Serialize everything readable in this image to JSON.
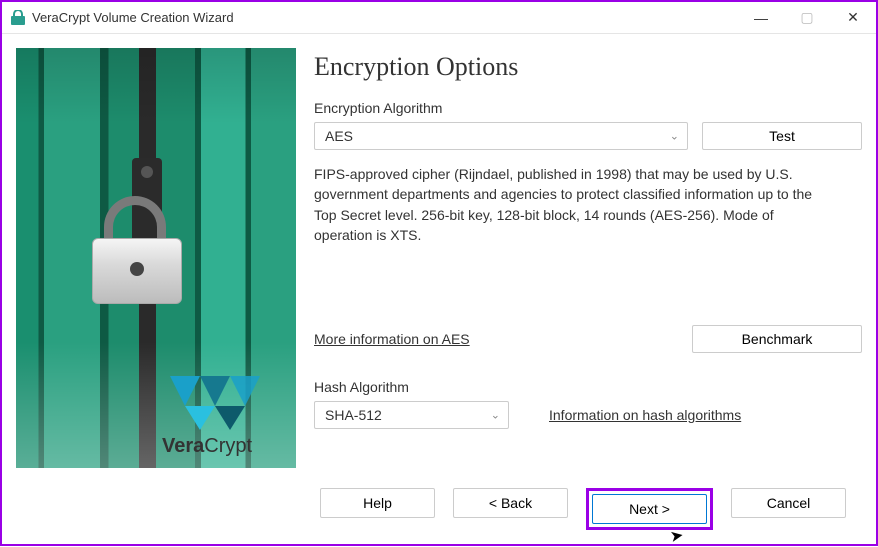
{
  "window": {
    "title": "VeraCrypt Volume Creation Wizard"
  },
  "page": {
    "title": "Encryption Options"
  },
  "encryption": {
    "label": "Encryption Algorithm",
    "selected": "AES",
    "test_button": "Test",
    "description": "FIPS-approved cipher (Rijndael, published in 1998) that may be used by U.S. government departments and agencies to protect classified information up to the Top Secret level. 256-bit key, 128-bit block, 14 rounds (AES-256). Mode of operation is XTS.",
    "more_info_link": "More information on AES",
    "benchmark_button": "Benchmark"
  },
  "hash": {
    "label": "Hash Algorithm",
    "selected": "SHA-512",
    "info_link": "Information on hash algorithms"
  },
  "footer": {
    "help": "Help",
    "back": "< Back",
    "next": "Next >",
    "cancel": "Cancel"
  },
  "branding": {
    "product": "VeraCrypt"
  }
}
